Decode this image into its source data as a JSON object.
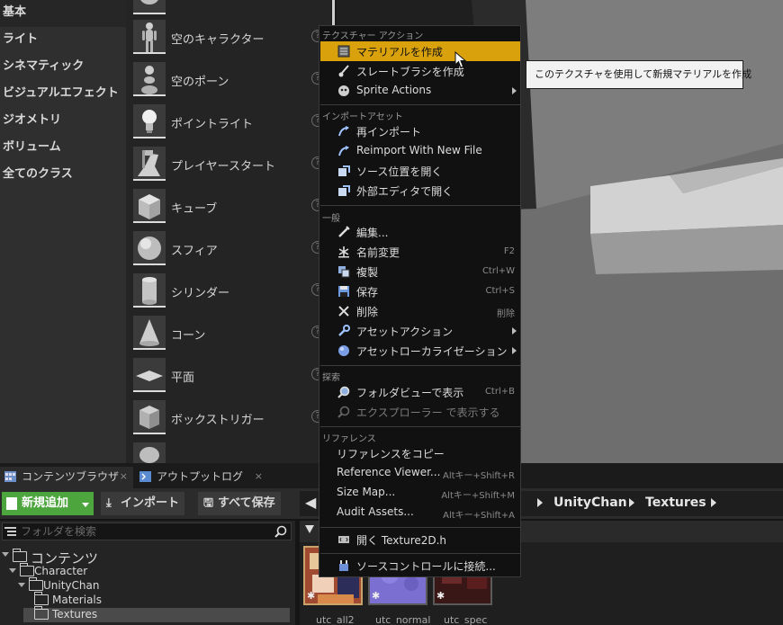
{
  "place_categories": [
    "基本",
    "ライト",
    "シネマティック",
    "ビジュアルエフェクト",
    "ジオメトリ",
    "ボリューム",
    "全てのクラス"
  ],
  "place_items": [
    {
      "label": "空のキャラクター",
      "icon": "character-mannequin-icon"
    },
    {
      "label": "空のポーン",
      "icon": "pawn-icon"
    },
    {
      "label": "ポイントライト",
      "icon": "lightbulb-icon"
    },
    {
      "label": "プレイヤースタート",
      "icon": "player-start-icon"
    },
    {
      "label": "キューブ",
      "icon": "cube-icon"
    },
    {
      "label": "スフィア",
      "icon": "sphere-icon"
    },
    {
      "label": "シリンダー",
      "icon": "cylinder-icon"
    },
    {
      "label": "コーン",
      "icon": "cone-icon"
    },
    {
      "label": "平面",
      "icon": "plane-icon"
    },
    {
      "label": "ボックストリガー",
      "icon": "box-trigger-icon"
    }
  ],
  "help_glyph": "?",
  "context_menu": {
    "sections": {
      "texture_actions": "テクスチャー アクション",
      "import_asset": "インポートアセット",
      "general": "一般",
      "explore": "探索",
      "references": "リファレンス"
    },
    "texture_actions": [
      {
        "label": "マテリアルを作成",
        "icon": "material-icon",
        "highlighted": true
      },
      {
        "label": "スレートブラシを作成",
        "icon": "brush-icon"
      },
      {
        "label": "Sprite Actions",
        "icon": "sprite-icon",
        "submenu": true
      }
    ],
    "import_asset": [
      {
        "label": "再インポート",
        "icon": "reimport-icon"
      },
      {
        "label": "Reimport With New File",
        "icon": "reimport-icon"
      },
      {
        "label": "ソース位置を開く",
        "icon": "open-source-icon"
      },
      {
        "label": "外部エディタで開く",
        "icon": "external-editor-icon"
      }
    ],
    "general": [
      {
        "label": "編集...",
        "icon": "edit-icon",
        "shortcut": ""
      },
      {
        "label": "名前変更",
        "icon": "rename-icon",
        "shortcut": "F2"
      },
      {
        "label": "複製",
        "icon": "duplicate-icon",
        "shortcut": "Ctrl+W"
      },
      {
        "label": "保存",
        "icon": "save-icon",
        "shortcut": "Ctrl+S"
      },
      {
        "label": "削除",
        "icon": "delete-icon",
        "shortcut": "削除"
      },
      {
        "label": "アセットアクション",
        "icon": "wrench-icon",
        "submenu": true
      },
      {
        "label": "アセットローカライゼーション",
        "icon": "globe-icon",
        "submenu": true
      }
    ],
    "explore": [
      {
        "label": "フォルダビューで表示",
        "icon": "magnifier-icon",
        "shortcut": "Ctrl+B"
      },
      {
        "label": "エクスプローラー で表示する",
        "icon": "magnifier-icon",
        "disabled": true
      }
    ],
    "references": [
      {
        "label": "リファレンスをコピー",
        "shortcut": ""
      },
      {
        "label": "Reference Viewer...",
        "shortcut": "Altキー+Shift+R"
      },
      {
        "label": "Size Map...",
        "shortcut": "Altキー+Shift+M"
      },
      {
        "label": "Audit Assets...",
        "shortcut": "Altキー+Shift+A"
      }
    ],
    "open_header": {
      "label": "開く Texture2D.h",
      "icon": "code-icon"
    },
    "source_control": {
      "label": "ソースコントロールに接続...",
      "icon": "source-control-icon"
    }
  },
  "tooltip": "このテクスチャを使用して新規マテリアルを作成",
  "bottom_tabs": [
    {
      "label": "コンテンツブラウザ",
      "active": true,
      "close": "×"
    },
    {
      "label": "アウトプットログ",
      "active": false,
      "close": "×"
    }
  ],
  "toolbar": {
    "new_button": "新規追加",
    "import_button": "インポート",
    "save_all_button": "すべて保存"
  },
  "breadcrumb": [
    "UnityChan",
    "Textures"
  ],
  "folder_search_placeholder": "フォルダを検索",
  "folder_tree": [
    {
      "label": "コンテンツ",
      "depth": 0,
      "expanded": true
    },
    {
      "label": "Character",
      "depth": 1,
      "expanded": true
    },
    {
      "label": "UnityChan",
      "depth": 2,
      "expanded": true
    },
    {
      "label": "Materials",
      "depth": 3
    },
    {
      "label": "Textures",
      "depth": 3,
      "selected": true
    }
  ],
  "assets": [
    {
      "name": "utc_all2",
      "color": "#c0573b"
    },
    {
      "name": "utc_normal",
      "color": "#7b6fd1"
    },
    {
      "name": "utc_spec",
      "color": "#6b2a2a"
    }
  ],
  "colors": {
    "highlight": "#d9a10c",
    "new_button": "#4da53d"
  }
}
